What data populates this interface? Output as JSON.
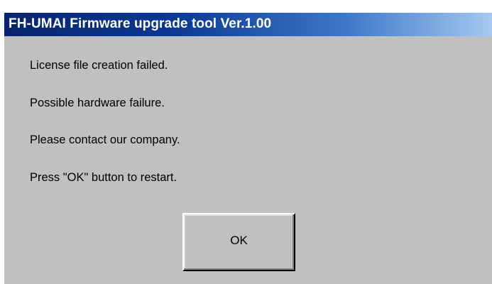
{
  "dialog": {
    "title": "FH-UMAI Firmware upgrade tool Ver.1.00",
    "messages": [
      "License file creation failed.",
      "Possible hardware failure.",
      "Please contact our company.",
      "Press \"OK\" button to restart."
    ],
    "ok_label": "OK"
  },
  "colors": {
    "titlebar_start": "#08246b",
    "titlebar_end": "#a6caf0",
    "window_face": "#c0c0c0",
    "title_text": "#ffffff"
  }
}
